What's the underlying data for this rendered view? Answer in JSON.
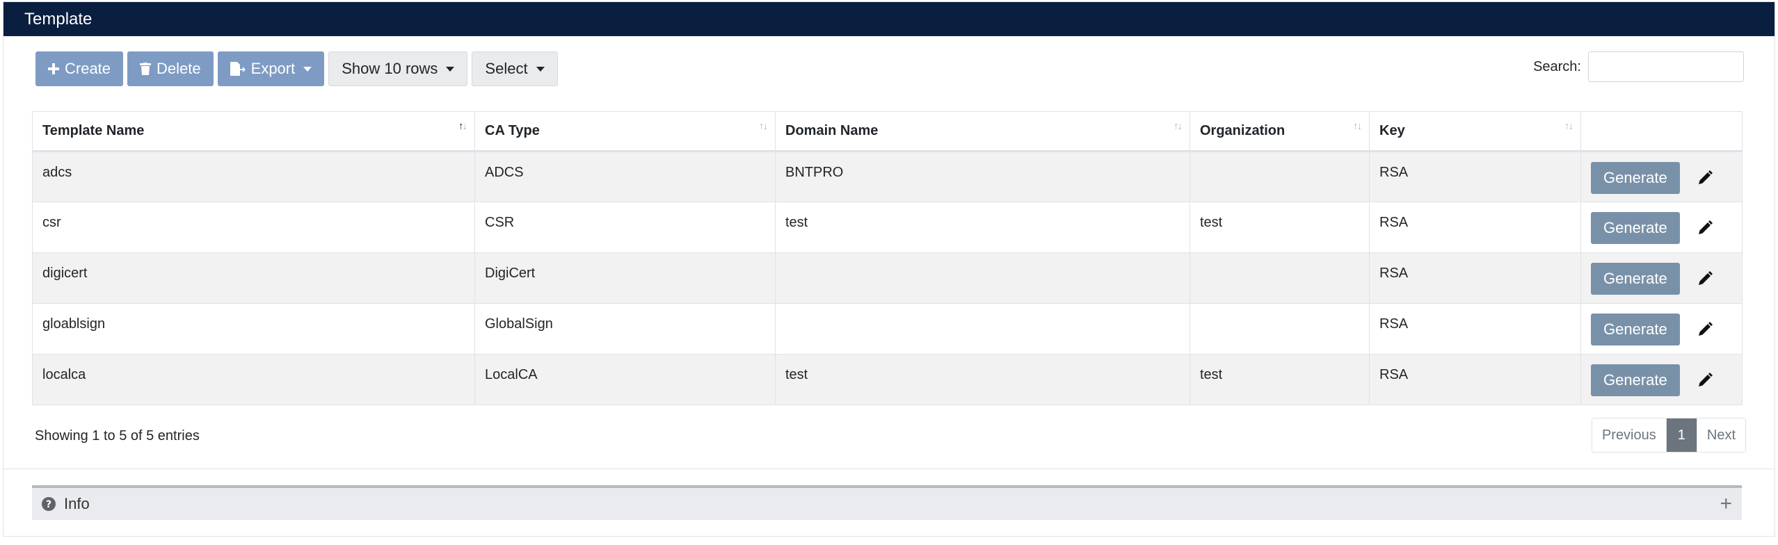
{
  "header": {
    "title": "Template"
  },
  "toolbar": {
    "create_label": "Create",
    "delete_label": "Delete",
    "export_label": "Export",
    "show_rows_label": "Show 10 rows",
    "select_label": "Select"
  },
  "search": {
    "label": "Search:",
    "value": "",
    "placeholder": ""
  },
  "table": {
    "columns": [
      "Template Name",
      "CA Type",
      "Domain Name",
      "Organization",
      "Key"
    ],
    "sorted_column": "Template Name",
    "rows": [
      {
        "name": "adcs",
        "ca_type": "ADCS",
        "domain": "BNTPRO",
        "organization": "",
        "key": "RSA",
        "action": "Generate"
      },
      {
        "name": "csr",
        "ca_type": "CSR",
        "domain": "test",
        "organization": "test",
        "key": "RSA",
        "action": "Generate"
      },
      {
        "name": "digicert",
        "ca_type": "DigiCert",
        "domain": "",
        "organization": "",
        "key": "RSA",
        "action": "Generate"
      },
      {
        "name": "gloablsign",
        "ca_type": "GlobalSign",
        "domain": "",
        "organization": "",
        "key": "RSA",
        "action": "Generate"
      },
      {
        "name": "localca",
        "ca_type": "LocalCA",
        "domain": "test",
        "organization": "test",
        "key": "RSA",
        "action": "Generate"
      }
    ]
  },
  "footer": {
    "info": "Showing 1 to 5 of 5 entries",
    "pagination": {
      "previous": "Previous",
      "current": "1",
      "next": "Next"
    }
  },
  "info_panel": {
    "label": "Info"
  },
  "colors": {
    "header_bg": "#0a1e3f",
    "primary_button": "#7e9bc4",
    "generate_button": "#7991a8"
  },
  "icons": [
    "plus-icon",
    "trash-icon",
    "export-file-icon",
    "sort-icon",
    "pencil-icon",
    "question-circle-icon",
    "expand-plus-icon"
  ]
}
